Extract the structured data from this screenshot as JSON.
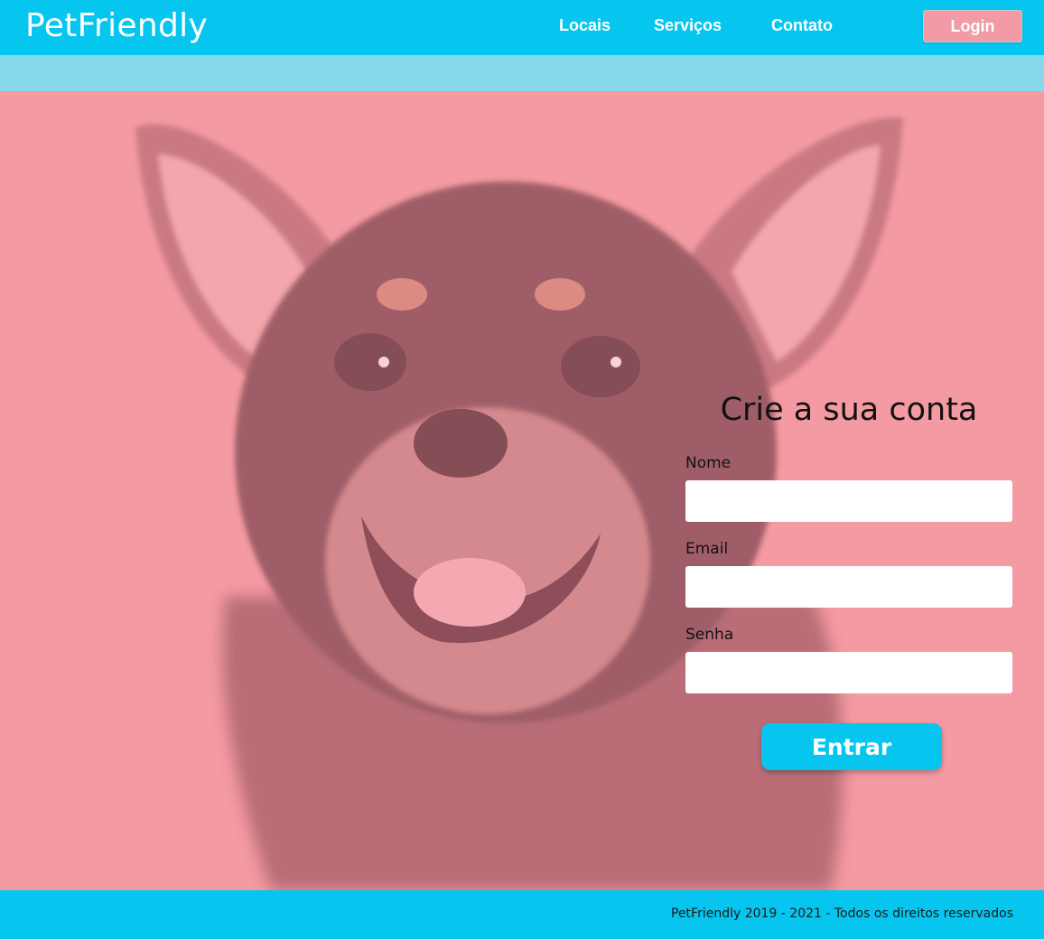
{
  "header": {
    "brand": "PetFriendly",
    "nav": {
      "locais": "Locais",
      "servicos": "Serviços",
      "contato": "Contato"
    },
    "login_label": "Login"
  },
  "form": {
    "title": "Crie a sua conta",
    "fields": [
      {
        "label": "Nome",
        "value": "",
        "placeholder": ""
      },
      {
        "label": "Email",
        "value": "",
        "placeholder": ""
      },
      {
        "label": "Senha",
        "value": "",
        "placeholder": ""
      }
    ],
    "submit_label": "Entrar"
  },
  "footer": {
    "text": "PetFriendly 2019 - 2021 - Todos os direitos reservados"
  },
  "colors": {
    "primary": "#06c6f0",
    "subbar": "#86d9ea",
    "hero_bg": "#f49aa2",
    "login_bg": "#f29aa5"
  },
  "hero": {
    "image": "chihuahua-photo"
  }
}
